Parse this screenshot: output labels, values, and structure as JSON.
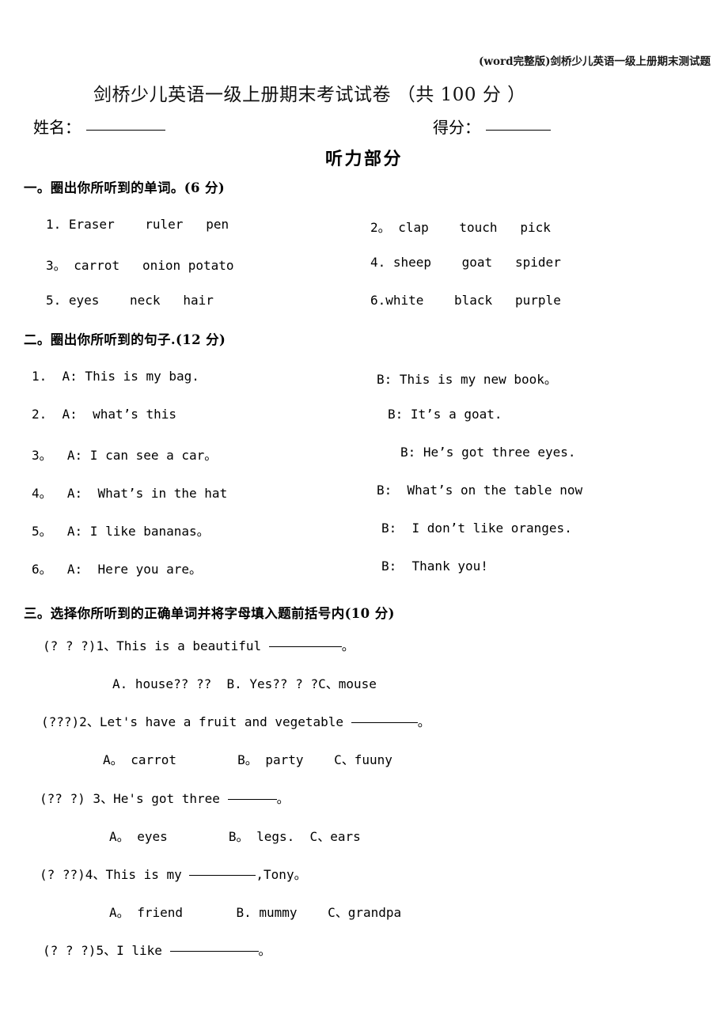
{
  "doc": {
    "running_header": "(word完整版)剑桥少儿英语一级上册期末测试题",
    "title": "剑桥少儿英语一级上册期末考试试卷  （共 100 分 ）",
    "name_label": "姓名：",
    "score_label": "得分：",
    "listening_section_title": "听力部分"
  },
  "section1": {
    "heading": "一。圈出你所听到的单词。(6 分)",
    "rows": [
      {
        "num": "1.",
        "words": " Eraser    ruler   pen"
      },
      {
        "num": "2。",
        "words": " clap    touch   pick"
      },
      {
        "num": "3。",
        "words": " carrot   onion potato"
      },
      {
        "num": "4.",
        "words": " sheep    goat   spider"
      },
      {
        "num": "5.",
        "words": " eyes    neck   hair"
      },
      {
        "num": "6.",
        "words": "white    black   purple"
      }
    ]
  },
  "section2": {
    "heading": "二。圈出你所听到的句子.(12 分)",
    "rows": [
      {
        "num": "1.",
        "a": "  A: This is my bag.",
        "b": "B: This is my new book。"
      },
      {
        "num": "2.",
        "a": "  A:  what’s this",
        "b": "B: It’s a goat."
      },
      {
        "num": "3。",
        "a": "  A: I can see a car。",
        "b": "B: He’s got three eyes."
      },
      {
        "num": "4。",
        "a": "  A:  What’s in the hat",
        "b": "B:  What’s on the table now"
      },
      {
        "num": "5。",
        "a": "  A: I like bananas。",
        "b": "B:  I don’t like oranges."
      },
      {
        "num": "6。",
        "a": "  A:  Here you are。",
        "b": "B:  Thank you!"
      }
    ]
  },
  "section3": {
    "heading": "三。选择你所听到的正确单词并将字母填入题前括号内(10 分)",
    "questions": [
      {
        "bracket": "(? ? ?)",
        "number": "1、",
        "stem_before": "This is a beautiful ",
        "stem_after": "。",
        "options": "A. house?? ??  B. Yes?? ? ?C、mouse"
      },
      {
        "bracket": "(???)",
        "number": "2、",
        "stem_before": "Let's have a fruit and vegetable ",
        "stem_after": "。",
        "options": "A。 carrot        B。 party    C、fuuny"
      },
      {
        "bracket": "(?? ?)",
        "number": " 3、",
        "stem_before": "He's got three ",
        "stem_after": "。",
        "options": "A。 eyes        B。 legs.  C、ears"
      },
      {
        "bracket": "(? ??)",
        "number": "4、",
        "stem_before": "This is my ",
        "stem_after": ",Tony。",
        "options": "A。 friend       B. mummy    C、grandpa"
      },
      {
        "bracket": "(? ? ?)",
        "number": "5、",
        "stem_before": "I like ",
        "stem_after": "。",
        "options": ""
      }
    ]
  }
}
